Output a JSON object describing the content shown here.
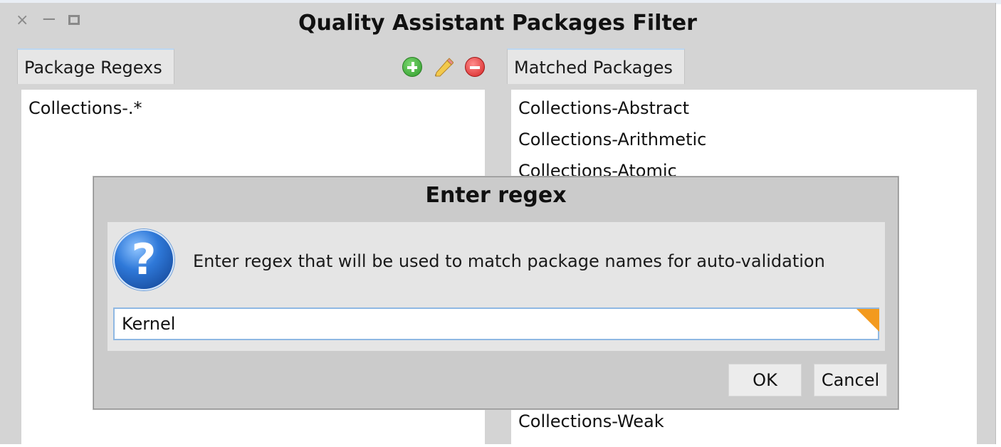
{
  "window": {
    "title": "Quality Assistant Packages Filter",
    "controls": {
      "close": "×",
      "minimize": "−"
    }
  },
  "left_panel": {
    "tab_label": "Package Regexs",
    "toolbar": {
      "add_icon": "add-circle-icon",
      "edit_icon": "pencil-icon",
      "remove_icon": "remove-circle-icon"
    },
    "items": [
      "Collections-.*"
    ]
  },
  "right_panel": {
    "tab_label": "Matched Packages",
    "items": [
      "Collections-Abstract",
      "Collections-Arithmetic",
      "Collections-Atomic",
      "Collections-Weak"
    ]
  },
  "dialog": {
    "title": "Enter regex",
    "icon": "question-icon",
    "icon_glyph": "?",
    "prompt": "Enter regex that will be used to match package names for auto-validation",
    "input_value": "Kernel",
    "ok_label": "OK",
    "cancel_label": "Cancel"
  },
  "colors": {
    "window_bg": "#d4d4d4",
    "tab_accent": "#bcd7f1",
    "input_focus_border": "#8fb8e3",
    "corner_marker": "#f39a1e"
  }
}
